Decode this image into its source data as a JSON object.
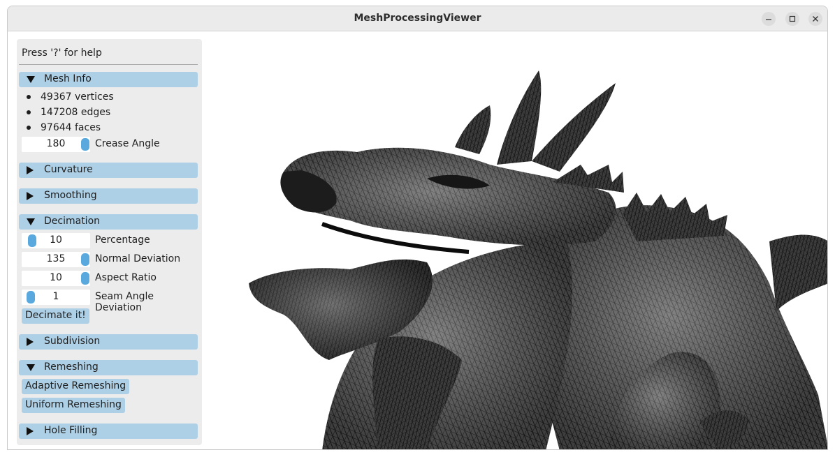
{
  "window": {
    "title": "MeshProcessingViewer",
    "controls": [
      "minimize-icon",
      "maximize-icon",
      "close-icon"
    ]
  },
  "panel": {
    "help_text": "Press '?' for help",
    "mesh_info": {
      "header": "Mesh Info",
      "expanded": true,
      "vertices": "49367 vertices",
      "edges": "147208 edges",
      "faces": "97644 faces",
      "crease_angle": {
        "value": "180",
        "label": "Crease Angle",
        "level": 1.0
      }
    },
    "curvature": {
      "header": "Curvature",
      "expanded": false
    },
    "smoothing": {
      "header": "Smoothing",
      "expanded": false
    },
    "decimation": {
      "header": "Decimation",
      "expanded": true,
      "percentage": {
        "value": "10",
        "label": "Percentage",
        "level": 0.0
      },
      "normal_deviation": {
        "value": "135",
        "label": "Normal Deviation",
        "level": 1.0
      },
      "aspect_ratio": {
        "value": "10",
        "label": "Aspect Ratio",
        "level": 1.0
      },
      "seam_angle_deviation": {
        "value": "1",
        "label": "Seam Angle Deviation",
        "level": 0.0
      },
      "button": "Decimate it!"
    },
    "subdivision": {
      "header": "Subdivision",
      "expanded": false
    },
    "remeshing": {
      "header": "Remeshing",
      "expanded": true,
      "adaptive_button": "Adaptive Remeshing",
      "uniform_button": "Uniform Remeshing"
    },
    "hole_filling": {
      "header": "Hole Filling",
      "expanded": false
    }
  },
  "colors": {
    "header_bg": "#aed0e6",
    "slider_knob": "#5aa9de",
    "panel_bg": "#ececec",
    "mesh_fill": "#3a3a3a"
  }
}
